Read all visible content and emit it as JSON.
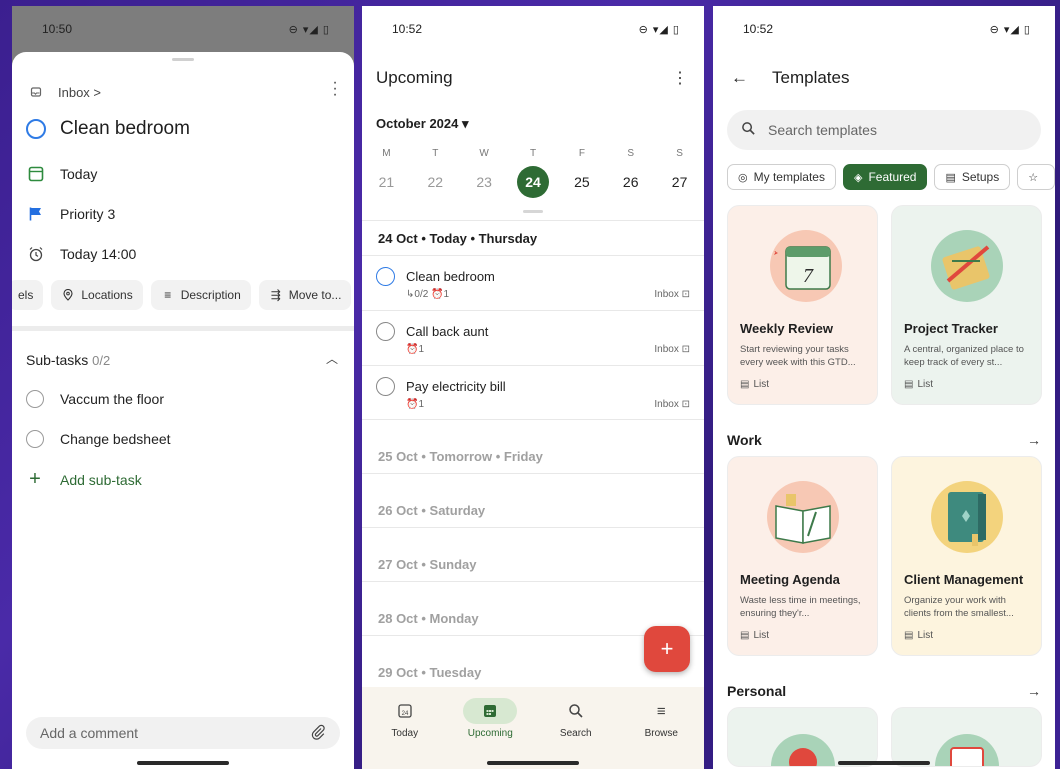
{
  "screen1": {
    "status": {
      "time": "10:50",
      "icons": "⊖ ▾◢ ▯"
    },
    "project": "Inbox >",
    "task_title": "Clean bedroom",
    "date": "Today",
    "priority": "Priority 3",
    "reminder": "Today 14:00",
    "chips": {
      "labels": "els",
      "locations": "Locations",
      "description": "Description",
      "move": "Move to..."
    },
    "subtasks": {
      "heading": "Sub-tasks",
      "count": "0/2",
      "items": [
        "Vaccum the floor",
        "Change bedsheet"
      ],
      "add": "Add sub-task"
    },
    "comment_placeholder": "Add a comment"
  },
  "screen2": {
    "status": {
      "time": "10:52",
      "icons": "⊖ ▾◢ ▯"
    },
    "title": "Upcoming",
    "month": "October 2024 ▾",
    "week": {
      "dows": [
        "M",
        "T",
        "W",
        "T",
        "F",
        "S",
        "S"
      ],
      "dates": [
        "21",
        "22",
        "23",
        "24",
        "25",
        "26",
        "27"
      ]
    },
    "sections": {
      "today": "24 Oct • Today • Thursday",
      "tomorrow": "25 Oct • Tomorrow • Friday",
      "sat": "26 Oct • Saturday",
      "sun": "27 Oct • Sunday",
      "mon": "28 Oct • Monday",
      "tue": "29 Oct • Tuesday"
    },
    "tasks": [
      {
        "title": "Clean bedroom",
        "meta": "↳0/2  ⏰1",
        "project": "Inbox"
      },
      {
        "title": "Call back aunt",
        "meta": "⏰1",
        "project": "Inbox"
      },
      {
        "title": "Pay electricity bill",
        "meta": "⏰1",
        "project": "Inbox"
      }
    ],
    "fab": "+",
    "nav": {
      "today": "Today",
      "upcoming": "Upcoming",
      "search": "Search",
      "browse": "Browse"
    }
  },
  "screen3": {
    "status": {
      "time": "10:52",
      "icons": "⊖ ▾◢ ▯"
    },
    "title": "Templates",
    "search_placeholder": "Search templates",
    "filters": {
      "my": "My templates",
      "featured": "Featured",
      "setups": "Setups"
    },
    "featured": [
      {
        "title": "Weekly Review",
        "desc": "Start reviewing your tasks every week with this GTD...",
        "type": "List"
      },
      {
        "title": "Project Tracker",
        "desc": "A central, organized place to keep track of every st...",
        "type": "List"
      }
    ],
    "work": {
      "heading": "Work",
      "cards": [
        {
          "title": "Meeting Agenda",
          "desc": "Waste less time in meetings, ensuring they'r...",
          "type": "List"
        },
        {
          "title": "Client Management",
          "desc": "Organize your work with clients from the smallest...",
          "type": "List"
        }
      ]
    },
    "personal": {
      "heading": "Personal"
    }
  }
}
